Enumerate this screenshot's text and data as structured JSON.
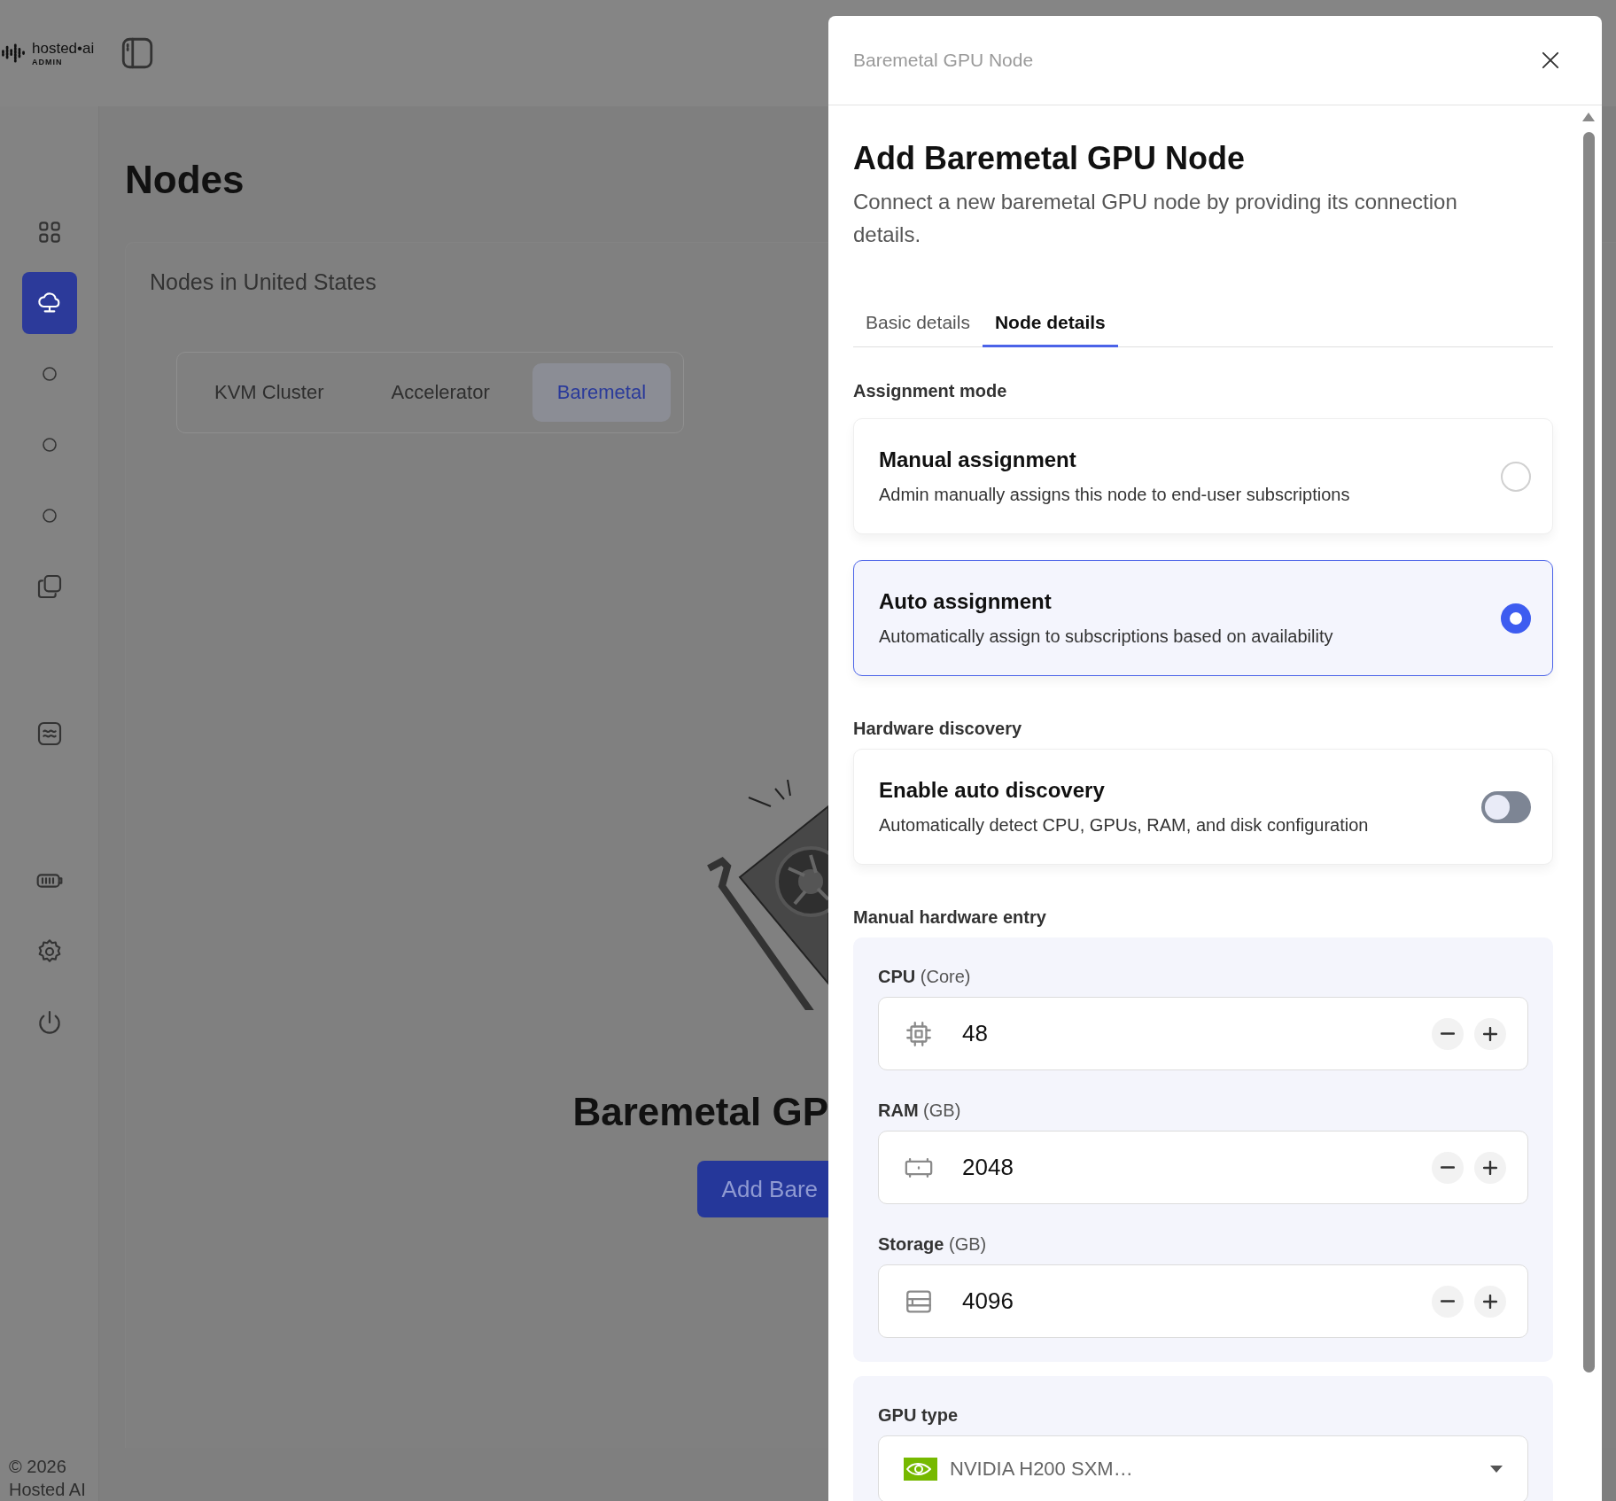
{
  "app": {
    "logo": "hosted•ai",
    "logo_sub": "ADMIN"
  },
  "sidebar": {
    "groups": [
      [
        {
          "kind": "grid",
          "selected": false
        },
        {
          "kind": "cloud",
          "selected": true
        },
        {
          "kind": "circle",
          "selected": false
        },
        {
          "kind": "circle",
          "selected": false
        },
        {
          "kind": "circle",
          "selected": false
        },
        {
          "kind": "copy",
          "selected": false
        }
      ],
      [
        {
          "kind": "wave",
          "selected": false
        }
      ],
      [
        {
          "kind": "battery",
          "selected": false
        },
        {
          "kind": "gear",
          "selected": false
        },
        {
          "kind": "power",
          "selected": false
        }
      ]
    ]
  },
  "footer": [
    "© 2026",
    "Hosted AI"
  ],
  "page": {
    "title": "Nodes",
    "card_title": "Nodes in United States",
    "segments": [
      {
        "label": "KVM Cluster",
        "selected": false
      },
      {
        "label": "Accelerator",
        "selected": false
      },
      {
        "label": "Baremetal",
        "selected": true
      }
    ],
    "empty_title": "Baremetal GP",
    "empty_button": "Add Bare"
  },
  "drawer": {
    "header": "Baremetal GPU Node",
    "title": "Add Baremetal GPU Node",
    "description": "Connect a new baremetal GPU node by providing its connection details.",
    "tabs": [
      {
        "label": "Basic details",
        "selected": false
      },
      {
        "label": "Node details",
        "selected": true
      }
    ],
    "assignment": {
      "label": "Assignment mode",
      "options": [
        {
          "title": "Manual assignment",
          "description": "Admin manually assigns this node to end-user subscriptions",
          "selected": false
        },
        {
          "title": "Auto assignment",
          "description": "Automatically assign to subscriptions based on availability",
          "selected": true
        }
      ]
    },
    "discovery": {
      "label": "Hardware discovery",
      "title": "Enable auto discovery",
      "description": "Automatically detect CPU, GPUs, RAM, and disk configuration",
      "on": false
    },
    "manual": {
      "label": "Manual hardware entry",
      "fields": [
        {
          "kind": "cpu",
          "label": "**CPU** (Core)",
          "value": "48"
        },
        {
          "kind": "ram",
          "label": "**RAM** (GB)",
          "value": "2048"
        },
        {
          "kind": "storage",
          "label": "**Storage** (GB)",
          "value": "4096"
        }
      ]
    },
    "gpu": {
      "label": "GPU type",
      "value": "NVIDIA H200 SXM…"
    }
  }
}
